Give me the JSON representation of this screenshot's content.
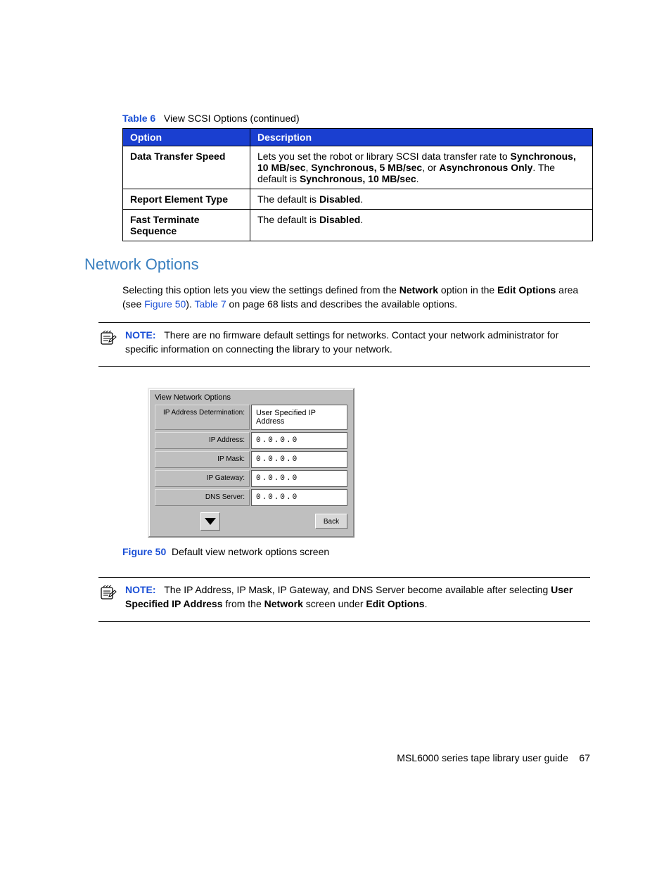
{
  "tableCaption": {
    "label": "Table 6",
    "text": "View SCSI Options (continued)"
  },
  "tableHeaders": {
    "option": "Option",
    "description": "Description"
  },
  "rows": [
    {
      "option": "Data Transfer Speed",
      "desc_pre": "Lets you set the robot or library SCSI data transfer rate to ",
      "desc_b1": "Synchronous, 10 MB/sec",
      "desc_mid1": ", ",
      "desc_b2": "Synchronous, 5 MB/sec",
      "desc_mid2": ", or ",
      "desc_b3": "Asynchronous Only",
      "desc_mid3": ". The default is ",
      "desc_b4": "Synchronous, 10 MB/sec",
      "desc_post": "."
    },
    {
      "option": "Report Element Type",
      "desc_pre": "The default is ",
      "desc_b1": "Disabled",
      "desc_post": "."
    },
    {
      "option": "Fast Terminate Sequence",
      "desc_pre": "The default is ",
      "desc_b1": "Disabled",
      "desc_post": "."
    }
  ],
  "sectionHeading": "Network Options",
  "intro": {
    "t1": "Selecting this option lets you view the settings defined from the ",
    "b1": "Network",
    "t2": " option in the ",
    "b2": "Edit Options",
    "t3": " area (see ",
    "x1": "Figure 50",
    "t4": "). ",
    "x2": "Table 7",
    "t5": " on page 68 lists and describes the available options."
  },
  "note1": {
    "label": "NOTE:",
    "text": "There are no firmware default settings for networks. Contact your network administrator for specific information on connecting the library to your network."
  },
  "lcd": {
    "title": "View Network Options",
    "rows": [
      {
        "label": "IP Address Determination:",
        "value": "User Specified IP Address"
      },
      {
        "label": "IP Address:",
        "value": "0.0.0.0"
      },
      {
        "label": "IP Mask:",
        "value": "0.0.0.0"
      },
      {
        "label": "IP Gateway:",
        "value": "0.0.0.0"
      },
      {
        "label": "DNS Server:",
        "value": "0.0.0.0"
      }
    ],
    "back": "Back"
  },
  "figCaption": {
    "label": "Figure 50",
    "text": "Default view network options screen"
  },
  "note2": {
    "label": "NOTE:",
    "t1": "The IP Address, IP Mask, IP Gateway, and DNS Server become available after selecting ",
    "b1": "User Specified IP Address",
    "t2": " from the ",
    "b2": "Network",
    "t3": " screen under ",
    "b3": "Edit Options",
    "t4": "."
  },
  "footer": {
    "title": "MSL6000 series tape library user guide",
    "page": "67"
  }
}
